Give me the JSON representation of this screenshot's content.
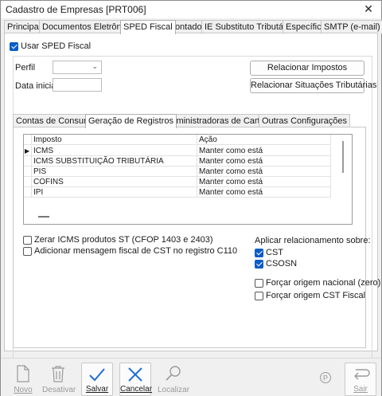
{
  "window": {
    "title": "Cadastro de Empresas [PRT006]"
  },
  "main_tabs": [
    {
      "label": "Principal"
    },
    {
      "label": "Documentos Eletrônicos"
    },
    {
      "label": "SPED Fiscal"
    },
    {
      "label": "Contador"
    },
    {
      "label": "IE Substituto Tributário"
    },
    {
      "label": "Específico"
    },
    {
      "label": "SMTP (e-mail)"
    }
  ],
  "sped": {
    "usar_label": "Usar SPED Fiscal",
    "usar_checked": true,
    "perfil_label": "Perfil",
    "perfil_value": "",
    "data_inicial_label": "Data inicial",
    "data_inicial_value": "",
    "relacionar_impostos_button": "Relacionar Impostos",
    "relacionar_situacoes_button": "Relacionar Situações Tributárias"
  },
  "sub_tabs": [
    {
      "label": "Contas de Consumo"
    },
    {
      "label": "Geração de Registros"
    },
    {
      "label": "Administradoras de Cartões"
    },
    {
      "label": "Outras Configurações"
    }
  ],
  "grid": {
    "columns": [
      "Imposto",
      "Ação"
    ],
    "rows": [
      {
        "imposto": "ICMS",
        "acao": "Manter como está"
      },
      {
        "imposto": "ICMS SUBSTITUIÇÃO TRIBUTÁRIA",
        "acao": "Manter como está"
      },
      {
        "imposto": "PIS",
        "acao": "Manter como está"
      },
      {
        "imposto": "COFINS",
        "acao": "Manter como está"
      },
      {
        "imposto": "IPI",
        "acao": "Manter como está"
      }
    ]
  },
  "options": {
    "zerar_icms": {
      "label": "Zerar ICMS produtos ST (CFOP 1403 e 2403)",
      "checked": false
    },
    "adicionar_msg": {
      "label": "Adicionar mensagem fiscal de CST no registro C110",
      "checked": false
    }
  },
  "aplicar": {
    "label": "Aplicar relacionamento sobre:",
    "cst": {
      "label": "CST",
      "checked": true
    },
    "csosn": {
      "label": "CSOSN",
      "checked": true
    },
    "forcar_nacional": {
      "label": "Forçar origem nacional (zero)",
      "checked": false
    },
    "forcar_cst": {
      "label": "Forçar origem CST Fiscal",
      "checked": false
    }
  },
  "toolbar": {
    "novo": "Novo",
    "desativar": "Desativar",
    "salvar": "Salvar",
    "cancelar": "Cancelar",
    "localizar": "Localizar",
    "p_badge": "P",
    "sair": "Sair"
  },
  "colors": {
    "accent": "#0a5cc7",
    "icon_blue": "#1f6fd1"
  }
}
